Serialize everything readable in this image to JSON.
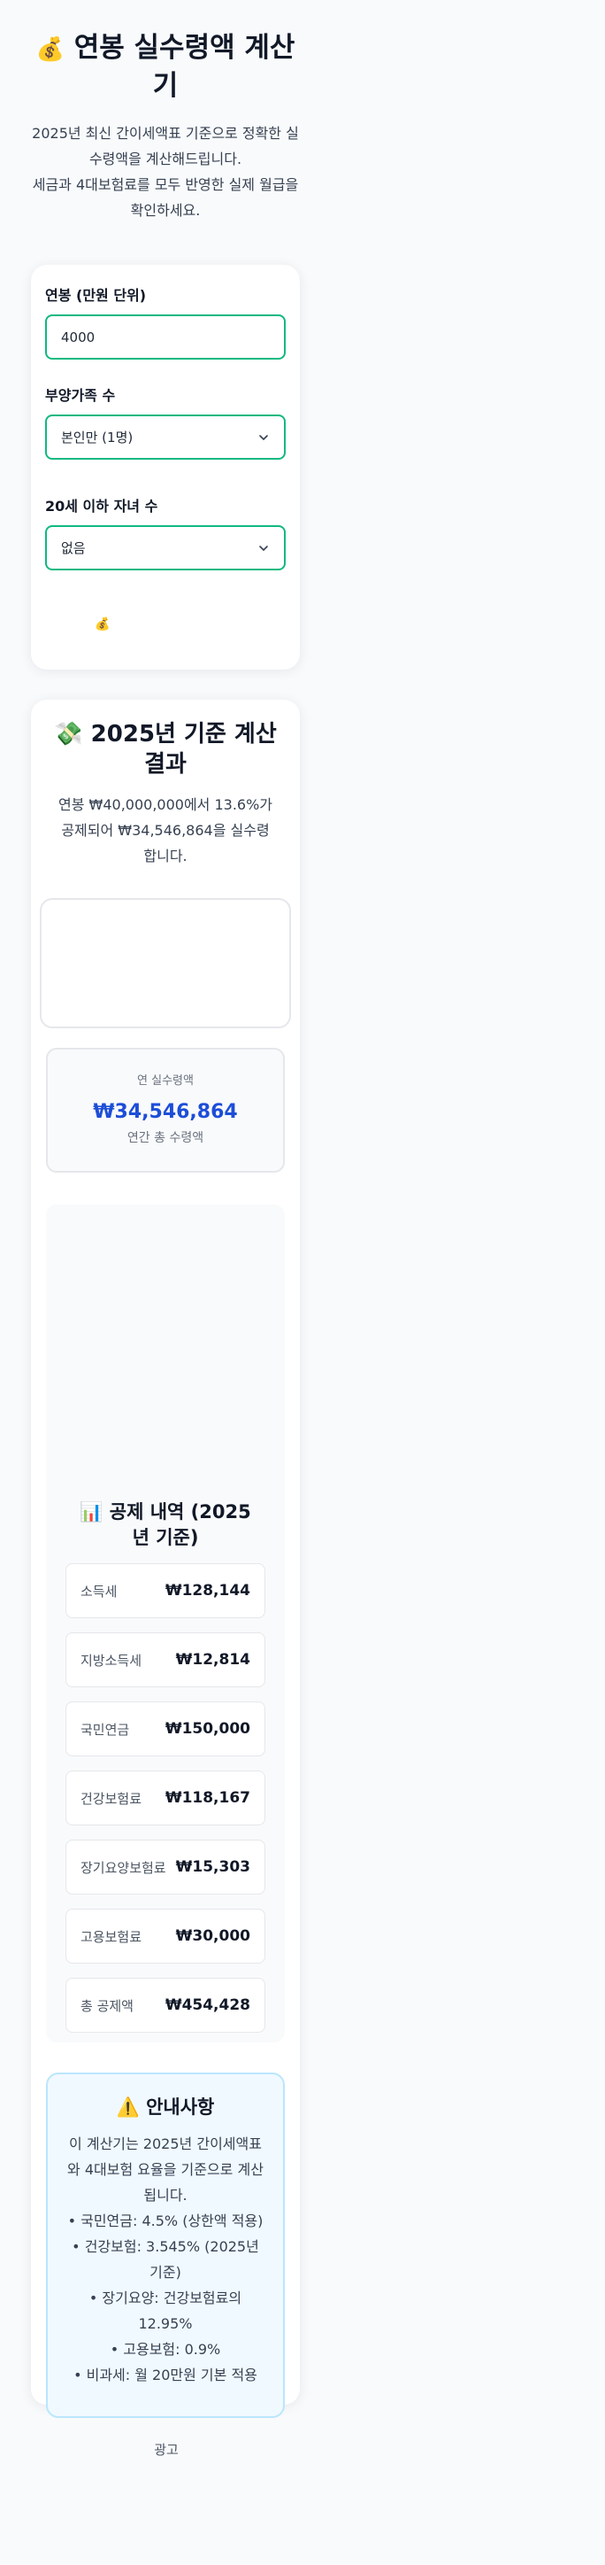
{
  "header": {
    "icon": "money-bag-icon",
    "title": "연봉 실수령액 계산기",
    "intro_line1": "2025년 최신 간이세액표 기준으로 정확한 실수령액을 계산해드립니다.",
    "intro_line2": "세금과 4대보험료를 모두 반영한 실제 월급을 확인하세요."
  },
  "form": {
    "salary_label": "연봉 (만원 단위)",
    "salary_value": "4000",
    "dependents_label": "부양가족 수",
    "dependents_value": "본인만 (1명)",
    "children_label": "20세 이하 자녀 수",
    "children_value": "없음",
    "calculate_icon": "money-bag-icon"
  },
  "result": {
    "icon": "money-with-wings-icon",
    "title": "2025년 기준 계산 결과",
    "summary": "연봉 ₩40,000,000에서 13.6%가 공제되어 ₩34,546,864을 실수령합니다.",
    "annual_label": "연 실수령액",
    "annual_value": "₩34,546,864",
    "annual_caption": "연간 총 수령액"
  },
  "deductions": {
    "icon": "bar-chart-icon",
    "title": "공제 내역 (2025년 기준)",
    "items": [
      {
        "name": "소득세",
        "amount": "₩128,144"
      },
      {
        "name": "지방소득세",
        "amount": "₩12,814"
      },
      {
        "name": "국민연금",
        "amount": "₩150,000"
      },
      {
        "name": "건강보험료",
        "amount": "₩118,167"
      },
      {
        "name": "장기요양보험료",
        "amount": "₩15,303"
      },
      {
        "name": "고용보험료",
        "amount": "₩30,000"
      },
      {
        "name": "총 공제액",
        "amount": "₩454,428"
      }
    ]
  },
  "notice": {
    "icon": "warning-icon",
    "title": "안내사항",
    "lines": [
      "이 계산기는 2025년 간이세액표와 4대보험 요율을 기준으로 계산됩니다.",
      "• 국민연금: 4.5% (상한액 적용)",
      "• 건강보험: 3.545% (2025년 기준)",
      "• 장기요양: 건강보험료의 12.95%",
      "• 고용보험: 0.9%",
      "• 비과세: 월 20만원 기본 적용"
    ]
  },
  "footer": {
    "ad_label": "광고"
  },
  "colors": {
    "accent_border": "#10b981",
    "annual_value": "#1d4ed8",
    "notice_bg": "#f0f9ff",
    "notice_border": "#bae6fd"
  }
}
